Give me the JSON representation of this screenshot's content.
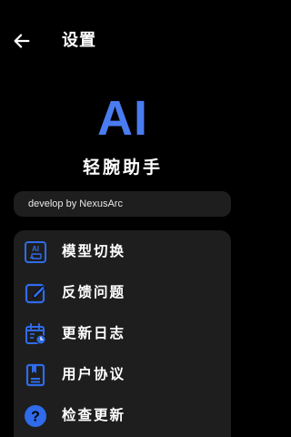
{
  "header": {
    "title": "设置",
    "back_icon": "arrow-left-icon"
  },
  "branding": {
    "logo_text": "AI",
    "app_name": "轻腕助手",
    "accent_color": "#4a7cf0"
  },
  "developer": {
    "text": "develop by NexusArc"
  },
  "menu": {
    "items": [
      {
        "label": "模型切换",
        "icon": "ai-model-icon"
      },
      {
        "label": "反馈问题",
        "icon": "edit-feedback-icon"
      },
      {
        "label": "更新日志",
        "icon": "calendar-log-icon"
      },
      {
        "label": "用户协议",
        "icon": "document-agreement-icon"
      },
      {
        "label": "检查更新",
        "icon": "question-circle-icon"
      }
    ]
  }
}
